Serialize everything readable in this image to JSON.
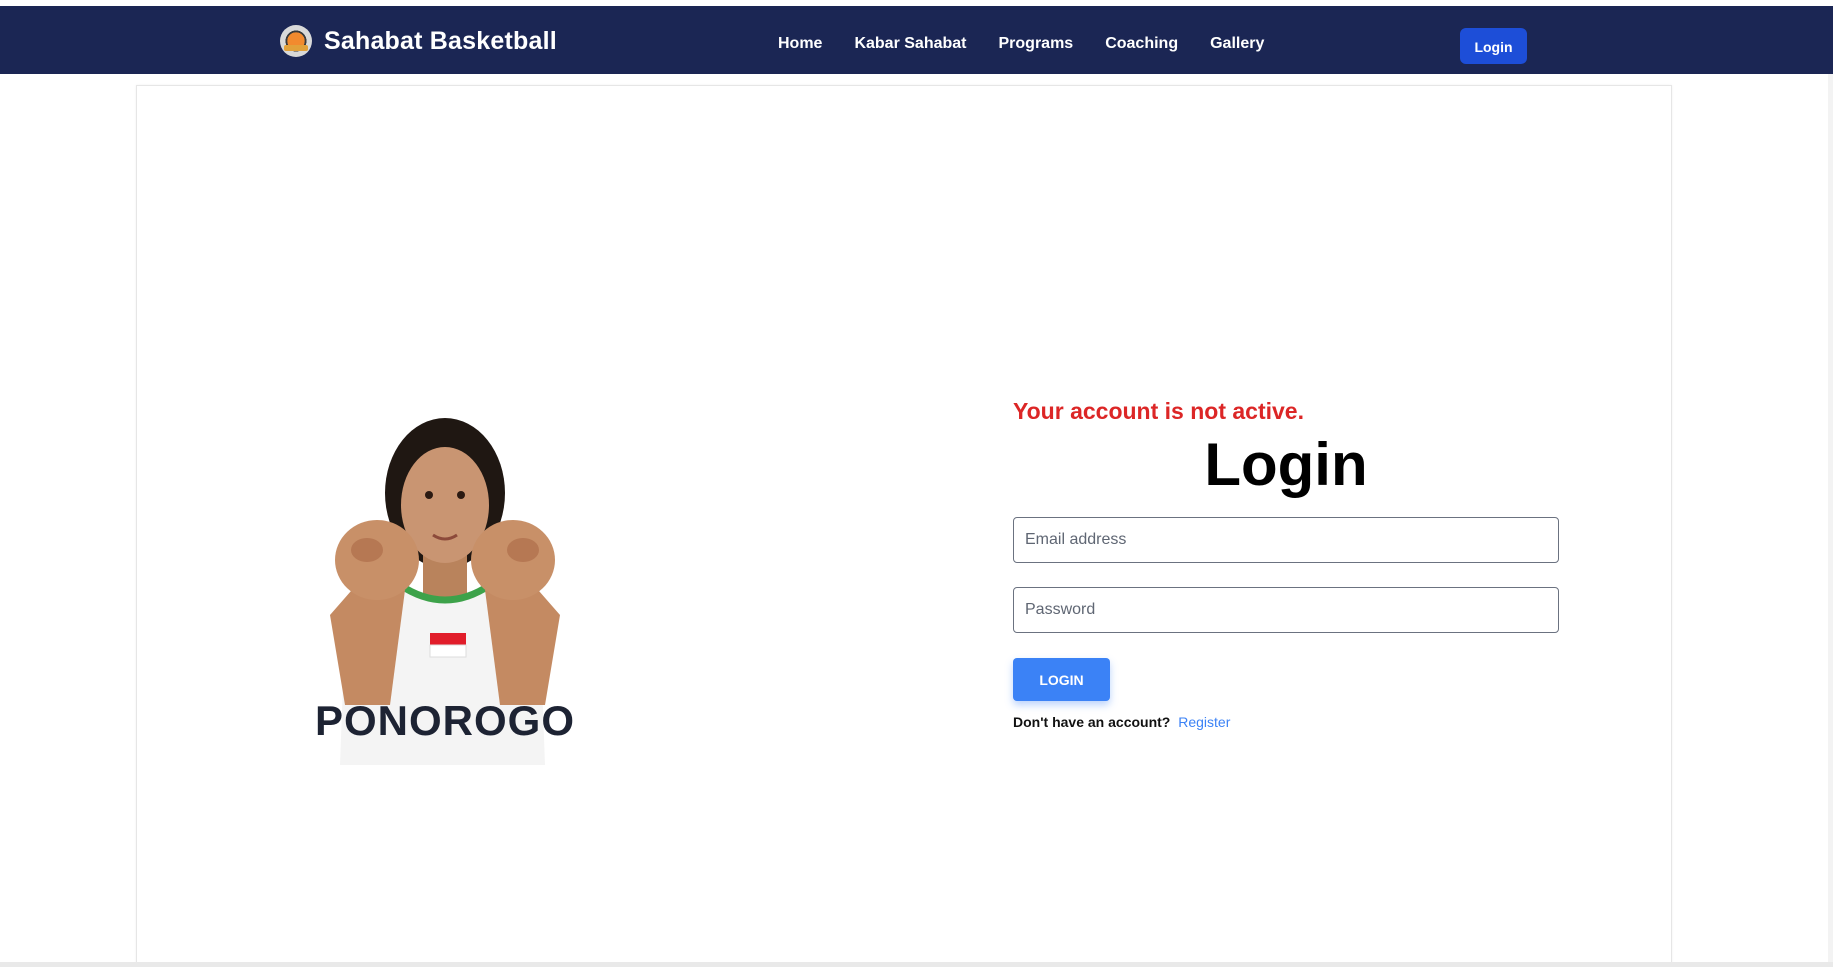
{
  "brand": {
    "name": "Sahabat Basketball",
    "logo_icon": "basketball-logo-icon"
  },
  "nav": {
    "links": [
      "Home",
      "Kabar Sahabat",
      "Programs",
      "Coaching",
      "Gallery"
    ],
    "login_label": "Login"
  },
  "hero": {
    "jersey_text": "PONOROGO"
  },
  "form": {
    "error": "Your account is not active.",
    "title": "Login",
    "email_placeholder": "Email address",
    "password_placeholder": "Password",
    "submit_label": "LOGIN",
    "signup_prompt": "Don't have an account?",
    "register_label": "Register"
  },
  "colors": {
    "navbar": "#1b2654",
    "primary": "#3b82f6",
    "nav_button": "#1d4ed8",
    "error": "#dc2626"
  }
}
